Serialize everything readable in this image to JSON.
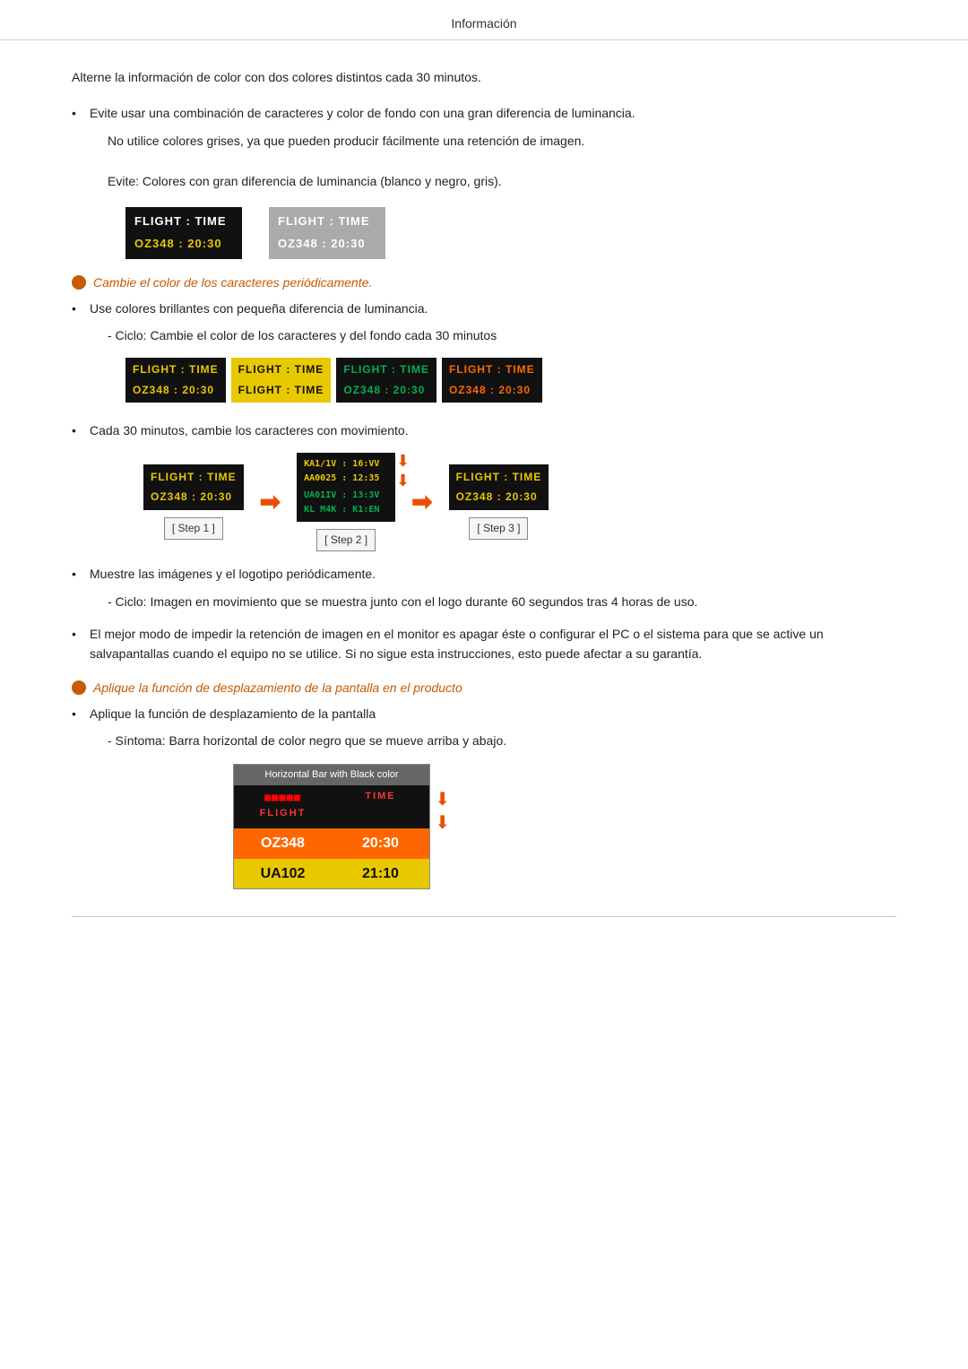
{
  "header": {
    "title": "Información"
  },
  "intro": {
    "para1": "Alterne la información de color con dos colores distintos cada 30 minutos.",
    "bullet1": "Evite usar una combinación de caracteres y color de fondo con una gran diferencia de luminancia.",
    "sub1": "No utilice colores grises, ya que pueden producir fácilmente una retención de imagen.",
    "sub2": "Evite: Colores con gran diferencia de luminancia (blanco y negro, gris)."
  },
  "demo1": {
    "dark": {
      "row1": "FLIGHT  :  TIME",
      "row2": "OZ348   :  20:30"
    },
    "gray": {
      "row1": "FLIGHT  :  TIME",
      "row2": "OZ348   :  20:30"
    }
  },
  "italic1": "Cambie el color de los caracteres periódicamente.",
  "bullet2": "Use colores brillantes con pequeña diferencia de luminancia.",
  "sub3": "- Ciclo: Cambie el color de los caracteres y del fondo cada 30 minutos",
  "cycle": {
    "box1": {
      "r1": "FLIGHT  :  TIME",
      "r2": "OZ348  :  20:30",
      "style": "cv1"
    },
    "box2": {
      "r1": "FLIGHT  :  TIME",
      "r2": "FLIGHT  :  TIME",
      "style": "cv2"
    },
    "box3": {
      "r1": "FLIGHT  :  TIME",
      "r2": "OZ348  :  20:30",
      "style": "cv3"
    },
    "box4": {
      "r1": "FLIGHT  :  TIME",
      "r2": "OZ348  :  20:30",
      "style": "cv4"
    }
  },
  "bullet3": "Cada 30 minutos, cambie los caracteres con movimiento.",
  "steps": {
    "step1": {
      "r1": "FLIGHT  :  TIME",
      "r2": "OZ348  :  20:30",
      "label": "[ Step 1 ]"
    },
    "step2": {
      "r1": "KA1/1V : 16:VV  AA0025 : 12:35",
      "r2": "UA01IV : 13:3V  KL M4K : K1:EN",
      "label": "[ Step 2 ]"
    },
    "step3": {
      "r1": "FLIGHT  :  TIME",
      "r2": "OZ348  :  20:30",
      "label": "[ Step 3 ]"
    }
  },
  "bullet4": "Muestre las imágenes y el logotipo periódicamente.",
  "sub4": "- Ciclo: Imagen en movimiento que se muestra junto con el logo durante 60 segundos tras 4 horas de uso.",
  "bullet5": "El mejor modo de impedir la retención de imagen en el monitor es apagar éste o configurar el PC o el sistema para que se active un salvapantallas cuando el equipo no se utilice. Si no sigue esta instrucciones, esto puede afectar a su garantía.",
  "italic2": "Aplique la función de desplazamiento de la pantalla en el producto",
  "bullet6": "Aplique la función de desplazamiento de la pantalla",
  "sub5": "- Síntoma: Barra horizontal de color negro que se mueve arriba y abajo.",
  "hbar": {
    "title": "Horizontal Bar with Black color",
    "header": {
      "c1": "FLIGHT",
      "c2": "TIME"
    },
    "row1": {
      "c1": "OZ348",
      "c2": "20:30"
    },
    "row2": {
      "c1": "UA102",
      "c2": "21:10"
    }
  }
}
